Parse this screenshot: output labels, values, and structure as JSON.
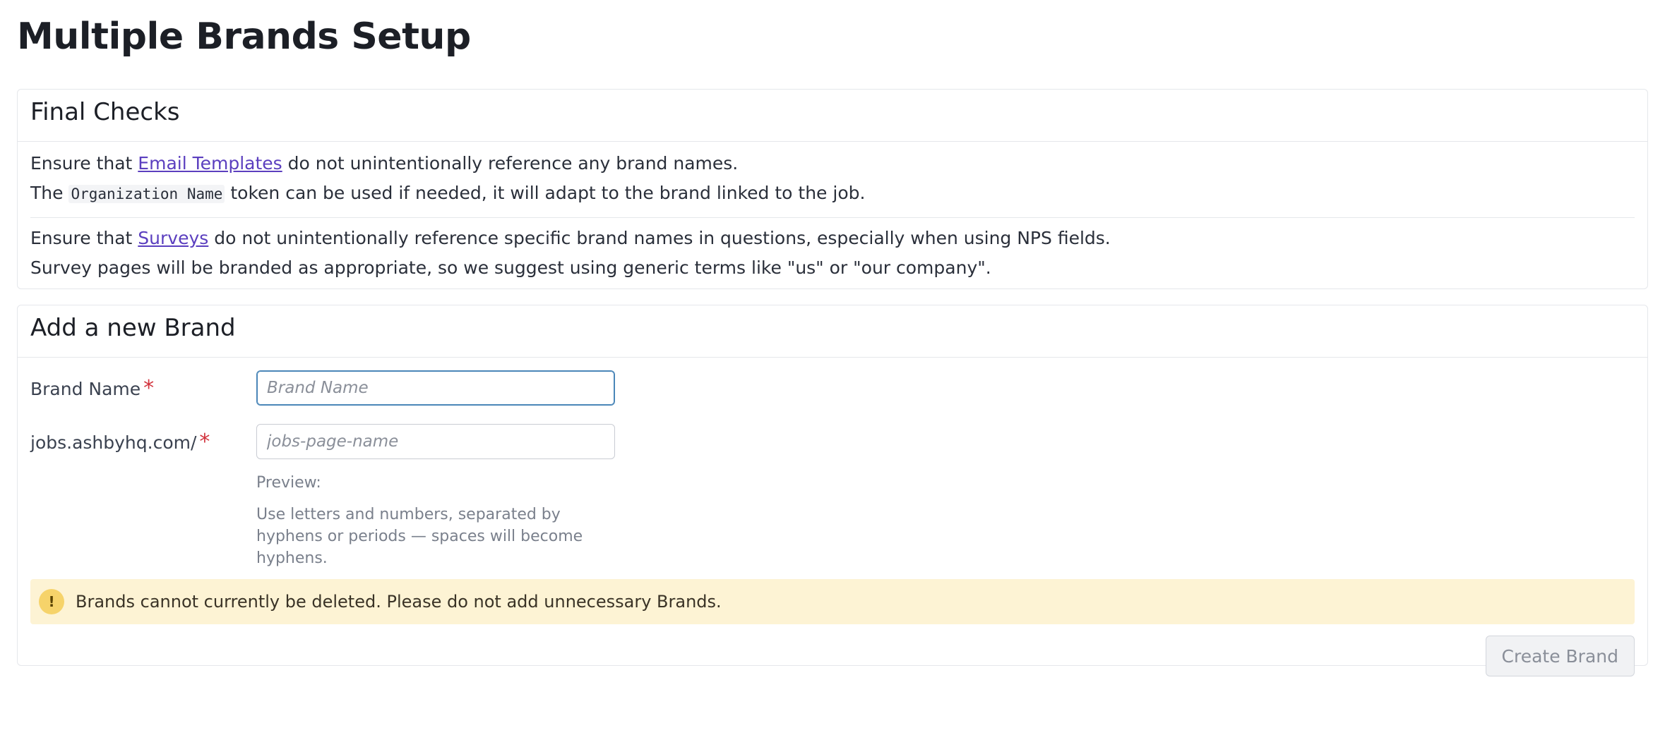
{
  "page": {
    "title": "Multiple Brands Setup"
  },
  "final_checks": {
    "title": "Final Checks",
    "email": {
      "prefix": "Ensure that",
      "link": "Email Templates",
      "suffix": "do not unintentionally reference any brand names.",
      "line2_prefix": "The",
      "token": "Organization Name",
      "line2_suffix": "token can be used if needed, it will adapt to the brand linked to the job."
    },
    "surveys": {
      "prefix": "Ensure that",
      "link": "Surveys",
      "suffix": "do not unintentionally reference specific brand names in questions, especially when using NPS fields.",
      "line2": "Survey pages will be branded as appropriate, so we suggest using generic terms like \"us\" or \"our company\"."
    }
  },
  "add_brand": {
    "title": "Add a new Brand",
    "brand_name": {
      "label": "Brand Name",
      "required_mark": "*",
      "placeholder": "Brand Name",
      "value": ""
    },
    "jobs_page": {
      "label": "jobs.ashbyhq.com/",
      "required_mark": "*",
      "placeholder": "jobs-page-name",
      "value": ""
    },
    "preview_label": "Preview:",
    "hint": "Use letters and numbers, separated by hyphens or periods — spaces will become hyphens.",
    "alert": {
      "icon": "warning-icon",
      "glyph": "!",
      "text": "Brands cannot currently be deleted. Please do not add unnecessary Brands."
    },
    "submit_label": "Create Brand"
  },
  "colors": {
    "link": "#5b3fbf",
    "required": "#d2333d",
    "alert_bg": "#fdf3d4",
    "focus": "#4a86b8"
  }
}
